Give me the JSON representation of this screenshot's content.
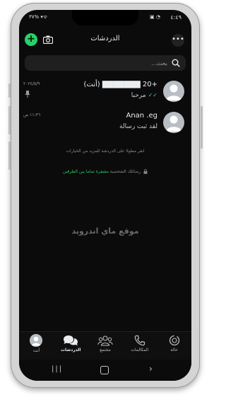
{
  "status_bar": {
    "time": "٤:٤٩",
    "left": "٣٧% ▾ᯤ",
    "right_icons": "▣ ◔"
  },
  "header": {
    "title": "الدردشات",
    "menu_label": "•••",
    "new_chat_label": "+"
  },
  "search": {
    "placeholder": "بحث..."
  },
  "chats": [
    {
      "name": "+20 ▇▇▇▇▇▇▇ (أنت)",
      "message": "مرحبا",
      "time": "٢٠٢٤/٥/٩",
      "ticks": "✓✓",
      "pinned": true
    },
    {
      "name": "Anan .eg",
      "message": "لقد ثبت رسالة",
      "time": "١١:٣٦ ص",
      "pinned": false
    }
  ],
  "hint_text": "انقر مطولا على الدردشة للمزيد من الخيارات",
  "encryption": {
    "prefix": "رسائلك الشخصية",
    "highlight": "مشفرة تماما بين الطرفين"
  },
  "watermark": "موقع ماي اندرويد",
  "bottom_nav": [
    {
      "label": "حالة",
      "icon": "status-icon"
    },
    {
      "label": "المكالمات",
      "icon": "phone-icon"
    },
    {
      "label": "مجتمع",
      "icon": "community-icon"
    },
    {
      "label": "الدردشات",
      "icon": "chats-icon",
      "active": true
    },
    {
      "label": "أنت",
      "icon": "profile-avatar"
    }
  ],
  "system_nav": {
    "recents": "|||",
    "back": "›"
  },
  "colors": {
    "accent": "#25d366",
    "background": "#0b0b0b",
    "read_ticks": "#53bdeb"
  }
}
